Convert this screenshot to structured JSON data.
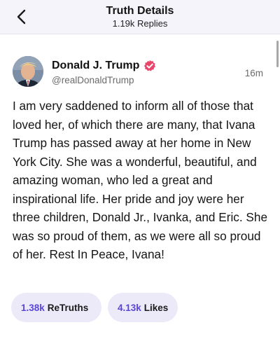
{
  "header": {
    "title": "Truth Details",
    "subtitle": "1.19k Replies"
  },
  "author": {
    "display_name": "Donald J. Trump",
    "handle": "@realDonaldTrump",
    "timestamp": "16m",
    "verified": true
  },
  "post": {
    "text": "I am very saddened to inform all of those that loved her, of which there are many, that Ivana Trump has passed away at her home in New York City. She was a wonderful, beautiful, and amazing woman, who led a great and inspirational life. Her pride and joy were her three children, Donald Jr., Ivanka, and Eric. She was so proud of them, as we were all so proud of her. Rest In Peace, Ivana!"
  },
  "stats": {
    "retruths_count": "1.38k",
    "retruths_label": "ReTruths",
    "likes_count": "4.13k",
    "likes_label": "Likes"
  },
  "colors": {
    "accent": "#5a46d6",
    "pill_background": "#eceaf9",
    "header_background": "#f5f4fb",
    "verified_badge": "#e8466a"
  },
  "icons": {
    "back": "chevron-left-icon",
    "verified": "verified-badge-icon"
  }
}
